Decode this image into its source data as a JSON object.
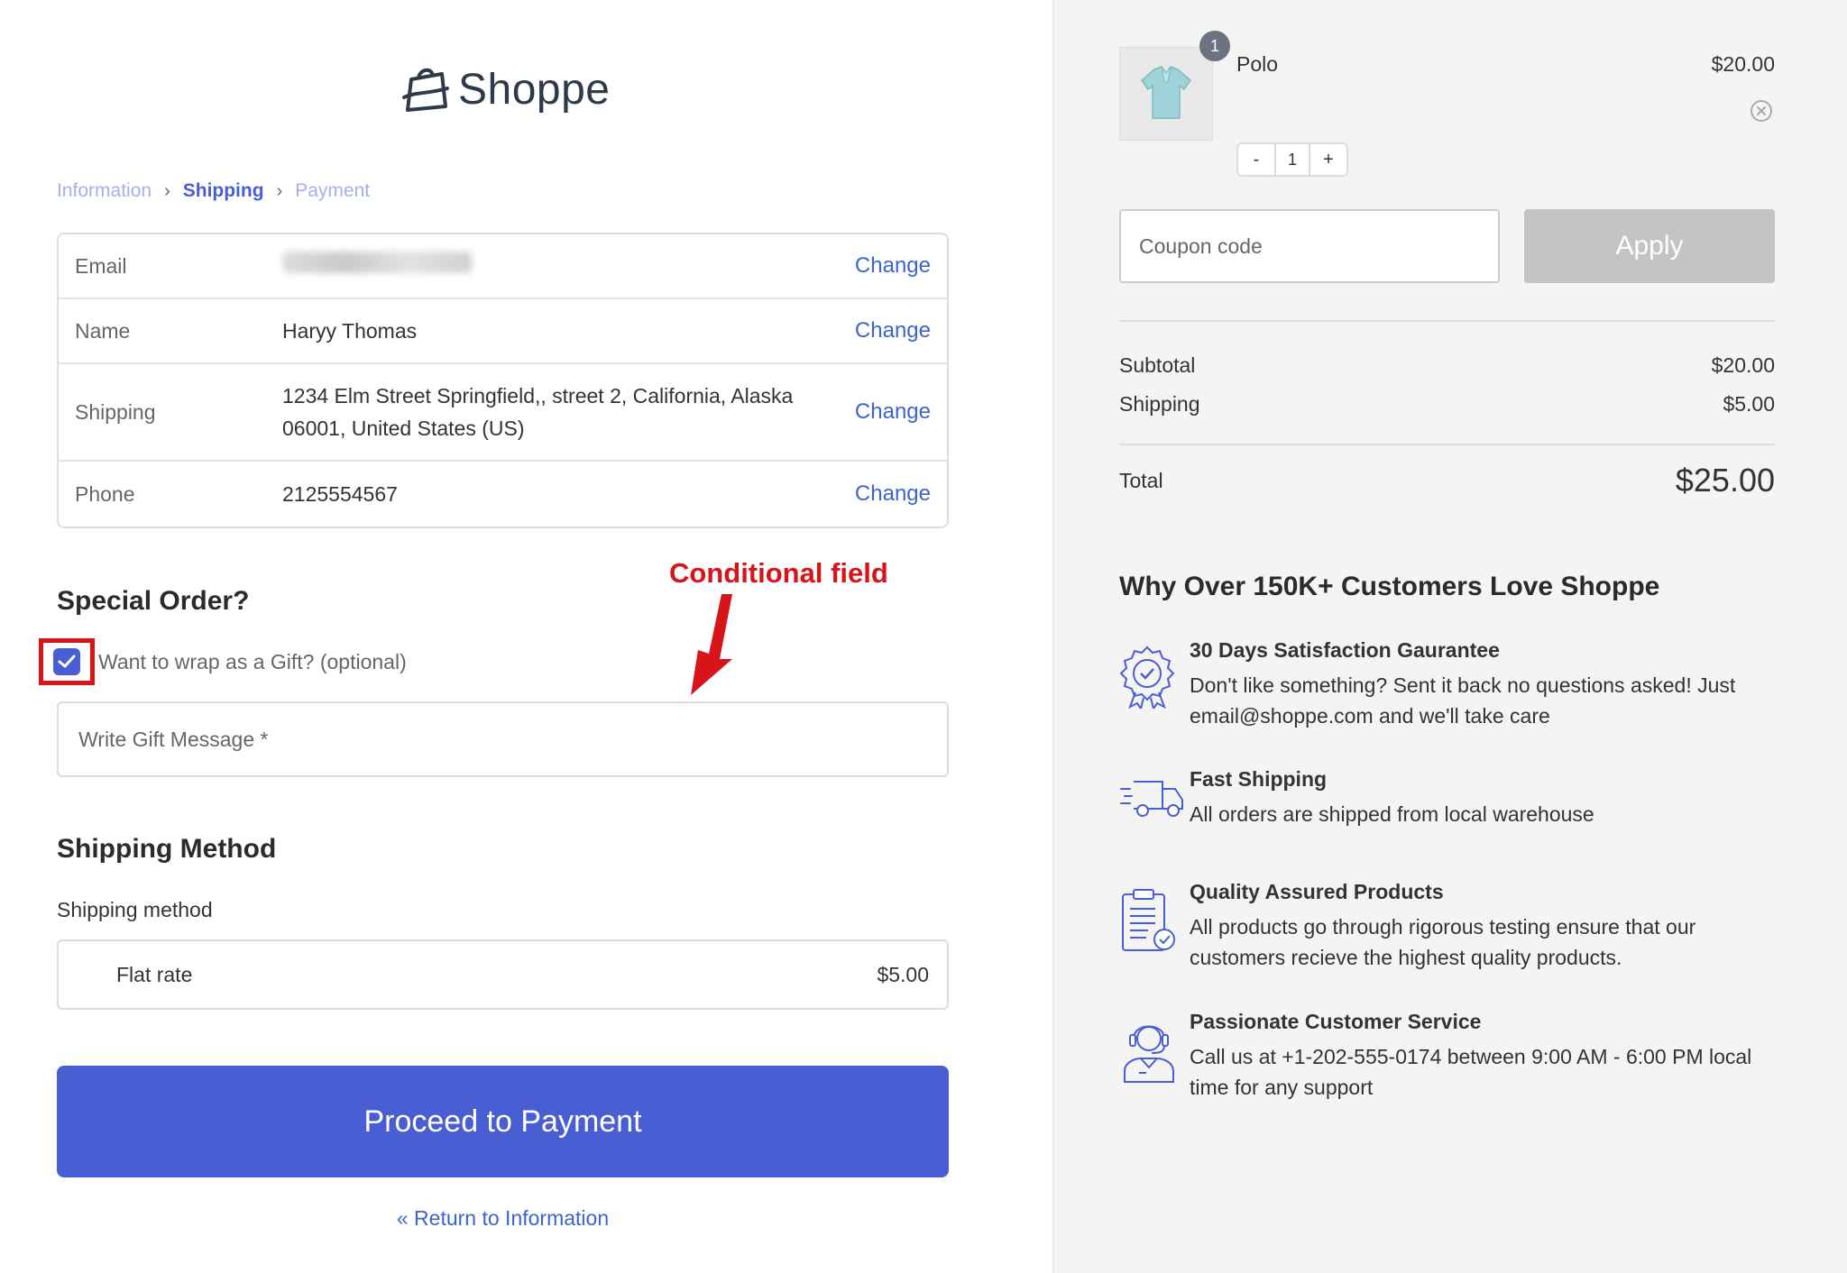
{
  "brand": {
    "name": "Shoppe",
    "accent": "#4a5ed3",
    "annotation_color": "#d7141a"
  },
  "breadcrumb": [
    {
      "label": "Information",
      "state": "visited"
    },
    {
      "label": "Shipping",
      "state": "active"
    },
    {
      "label": "Payment",
      "state": "upcoming"
    }
  ],
  "info": {
    "email": {
      "label": "Email",
      "value": "",
      "change": "Change"
    },
    "name": {
      "label": "Name",
      "value": "Haryy Thomas",
      "change": "Change"
    },
    "shipping": {
      "label": "Shipping",
      "value": "1234 Elm Street Springfield,, street 2, California, Alaska 06001, United States (US)",
      "change": "Change"
    },
    "phone": {
      "label": "Phone",
      "value": "2125554567",
      "change": "Change"
    }
  },
  "special_order": {
    "title": "Special Order?",
    "gift_label": "Want to wrap as a Gift? (optional)",
    "gift_checked": true,
    "gift_message_placeholder": "Write Gift Message *"
  },
  "annotation": {
    "text": "Conditional field"
  },
  "shipping_method": {
    "title": "Shipping Method",
    "label": "Shipping method",
    "option": "Flat rate",
    "price": "$5.00"
  },
  "actions": {
    "proceed": "Proceed to Payment",
    "return": "« Return to Information"
  },
  "cart": {
    "product_name": "Polo",
    "product_price": "$20.00",
    "badge_count": "1",
    "quantity": "1",
    "minus": "-",
    "plus": "+",
    "coupon_placeholder": "Coupon code",
    "apply_label": "Apply"
  },
  "summary": {
    "subtotal_label": "Subtotal",
    "subtotal": "$20.00",
    "shipping_label": "Shipping",
    "shipping": "$5.00",
    "total_label": "Total",
    "total": "$25.00"
  },
  "why": {
    "title": "Why Over 150K+ Customers Love Shoppe",
    "features": [
      {
        "icon": "badge-check-icon",
        "title": "30 Days Satisfaction Gaurantee",
        "desc": "Don't like something? Sent it back no questions asked! Just email@shoppe.com and we'll take care"
      },
      {
        "icon": "truck-icon",
        "title": "Fast Shipping",
        "desc": "All orders are shipped from local warehouse"
      },
      {
        "icon": "clipboard-check-icon",
        "title": "Quality Assured Products",
        "desc": "All products go through rigorous testing ensure that our customers recieve the highest quality products."
      },
      {
        "icon": "support-agent-icon",
        "title": "Passionate Customer Service",
        "desc": "Call us at +1-202-555-0174 between 9:00 AM - 6:00 PM local time for any support"
      }
    ]
  }
}
